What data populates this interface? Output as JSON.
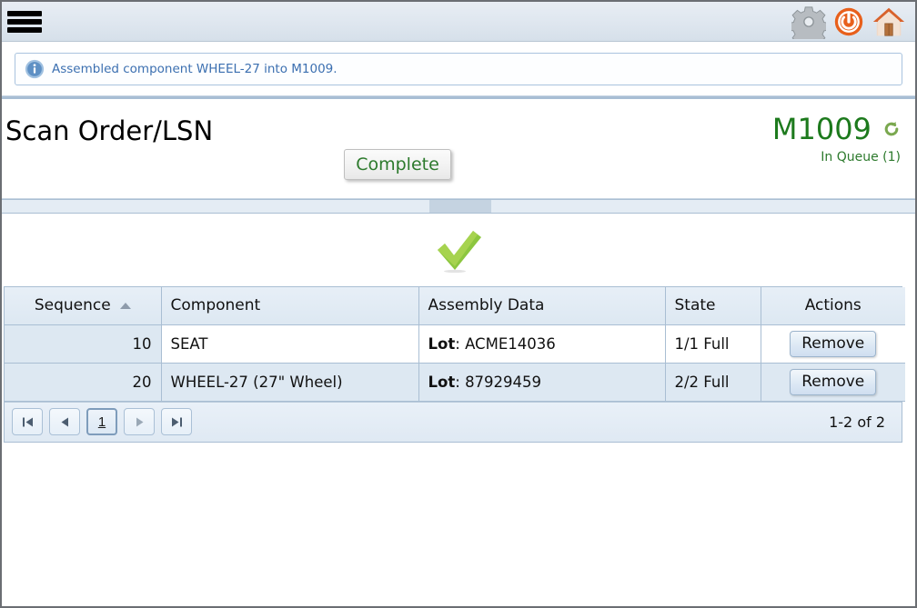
{
  "header": {
    "menu_icon": "hamburger-menu-icon",
    "icons": [
      {
        "name": "settings-gear-icon",
        "label": "Settings"
      },
      {
        "name": "power-off-icon",
        "label": "Logout"
      },
      {
        "name": "home-icon",
        "label": "Home"
      }
    ]
  },
  "message": {
    "icon": "info-icon",
    "text": "Assembled component WHEEL-27 into M1009."
  },
  "title_section": {
    "page_title": "Scan Order/LSN",
    "complete_label": "Complete",
    "lsn_id": "M1009",
    "refresh_icon": "refresh-icon",
    "queue_status": "In Queue (1)"
  },
  "status": {
    "check_icon": "green-check-icon"
  },
  "grid": {
    "columns": [
      "Sequence",
      "Component",
      "Assembly Data",
      "State",
      "Actions"
    ],
    "sort_column": "Sequence",
    "sort_direction": "asc",
    "rows": [
      {
        "sequence": "10",
        "component": "SEAT",
        "assembly_label": "Lot",
        "assembly_value": "ACME14036",
        "state": "1/1 Full",
        "action_label": "Remove"
      },
      {
        "sequence": "20",
        "component": "WHEEL-27 (27\" Wheel)",
        "assembly_label": "Lot",
        "assembly_value": "87929459",
        "state": "2/2 Full",
        "action_label": "Remove"
      }
    ]
  },
  "pager": {
    "first_label": "⏮",
    "prev_label": "◀",
    "current_page": "1",
    "next_label": "▶",
    "last_label": "⏭",
    "status": "1-2 of 2"
  },
  "colors": {
    "accent_green": "#1d7a1d",
    "info_blue": "#3b6fb0",
    "grid_border": "#a9bed3",
    "row_alt": "#dde8f2",
    "power_orange": "#e8601c"
  }
}
